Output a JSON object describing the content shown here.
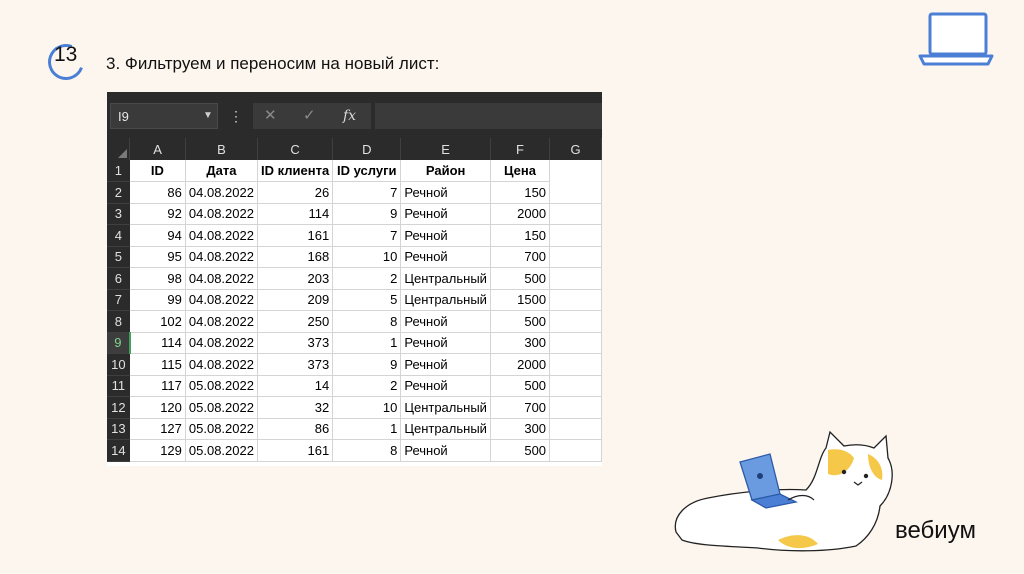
{
  "slide": {
    "number": "13",
    "title": "3. Фильтруем и переносим на новый лист:",
    "brand": "вебиум"
  },
  "excel": {
    "name_box": "I9",
    "formula_bar": {
      "cancel_icon": "✕",
      "enter_icon": "✓",
      "fx_label": "fx",
      "value": ""
    },
    "active_row": 9,
    "columns": [
      "A",
      "B",
      "C",
      "D",
      "E",
      "F",
      "G"
    ],
    "row_numbers": [
      "1",
      "2",
      "3",
      "4",
      "5",
      "6",
      "7",
      "8",
      "9",
      "10",
      "11",
      "12",
      "13",
      "14"
    ],
    "headers": [
      "ID",
      "Дата",
      "ID клиента",
      "ID услуги",
      "Район",
      "Цена"
    ],
    "rows": [
      [
        "86",
        "04.08.2022",
        "26",
        "7",
        "Речной",
        "150"
      ],
      [
        "92",
        "04.08.2022",
        "114",
        "9",
        "Речной",
        "2000"
      ],
      [
        "94",
        "04.08.2022",
        "161",
        "7",
        "Речной",
        "150"
      ],
      [
        "95",
        "04.08.2022",
        "168",
        "10",
        "Речной",
        "700"
      ],
      [
        "98",
        "04.08.2022",
        "203",
        "2",
        "Центральный",
        "500"
      ],
      [
        "99",
        "04.08.2022",
        "209",
        "5",
        "Центральный",
        "1500"
      ],
      [
        "102",
        "04.08.2022",
        "250",
        "8",
        "Речной",
        "500"
      ],
      [
        "114",
        "04.08.2022",
        "373",
        "1",
        "Речной",
        "300"
      ],
      [
        "115",
        "04.08.2022",
        "373",
        "9",
        "Речной",
        "2000"
      ],
      [
        "117",
        "05.08.2022",
        "14",
        "2",
        "Речной",
        "500"
      ],
      [
        "120",
        "05.08.2022",
        "32",
        "10",
        "Центральный",
        "700"
      ],
      [
        "127",
        "05.08.2022",
        "86",
        "1",
        "Центральный",
        "300"
      ],
      [
        "129",
        "05.08.2022",
        "161",
        "8",
        "Речной",
        "500"
      ]
    ]
  },
  "colors": {
    "accent": "#4b7fd6",
    "background": "#fdf6ee",
    "excel_dark": "#2b2b2b",
    "active_row_green": "#41a35a"
  }
}
